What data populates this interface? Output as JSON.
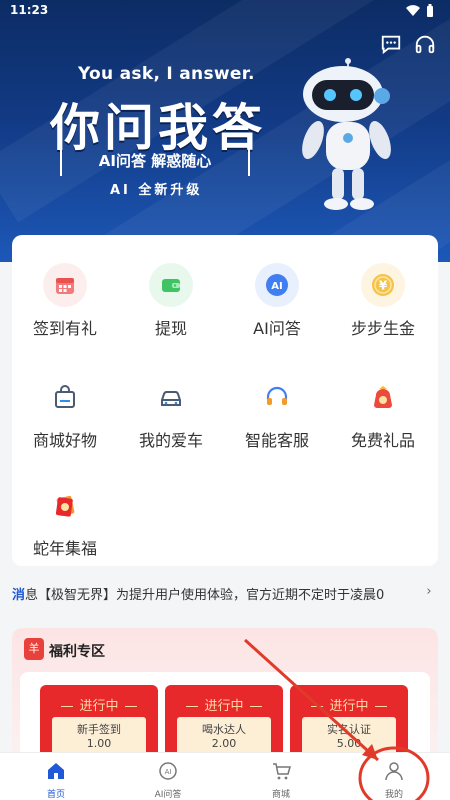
{
  "status_bar": {
    "time": "11:23"
  },
  "hero": {
    "tagline_en": "You ask, I answer.",
    "tagline_cn": "你问我答",
    "sub": "AI问答 解惑随心",
    "sub2": "AI 全新升级"
  },
  "menu": [
    {
      "label": "签到有礼",
      "icon": "calendar-icon"
    },
    {
      "label": "提现",
      "icon": "wallet-icon"
    },
    {
      "label": "AI问答",
      "icon": "ai-icon"
    },
    {
      "label": "步步生金",
      "icon": "coin-icon"
    },
    {
      "label": "商城好物",
      "icon": "shopping-bag-icon"
    },
    {
      "label": "我的爱车",
      "icon": "car-icon"
    },
    {
      "label": "智能客服",
      "icon": "headset-icon"
    },
    {
      "label": "免费礼品",
      "icon": "gift-bag-icon"
    },
    {
      "label": "蛇年集福",
      "icon": "fortune-card-icon"
    }
  ],
  "notice": {
    "prefix_blue": "消",
    "prefix_rest": "息",
    "text": "【极智无界】为提升用户使用体验，官方近期不定时于凌晨0"
  },
  "welfare": {
    "logo_char": "羊",
    "title": "福利专区",
    "tasks": [
      {
        "status": "进行中",
        "name": "新手签到",
        "points": "1.00"
      },
      {
        "status": "进行中",
        "name": "喝水达人",
        "points": "2.00"
      },
      {
        "status": "进行中",
        "name": "实名认证",
        "points": "5.00"
      }
    ]
  },
  "tabbar": {
    "items": [
      {
        "label": "首页",
        "icon": "home-icon"
      },
      {
        "label": "AI问答",
        "icon": "ai-chat-icon"
      },
      {
        "label": "商城",
        "icon": "cart-icon"
      },
      {
        "label": "我的",
        "icon": "person-icon"
      }
    ]
  },
  "colors": {
    "accent": "#1f59d6",
    "welfare_red": "#e8292b",
    "hero_dark": "#0c2c64",
    "annotation": "#e03a2a"
  }
}
